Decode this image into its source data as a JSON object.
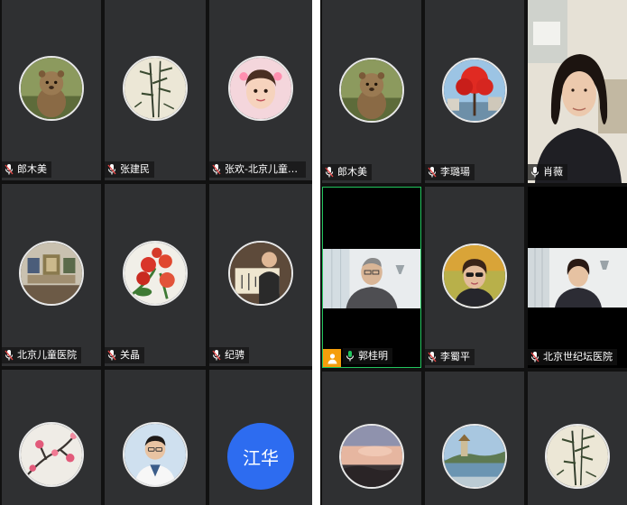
{
  "left_panel": {
    "tiles": [
      {
        "name": "郎木美",
        "mic": "muted",
        "avatar_icon": "quokka-avatar-icon"
      },
      {
        "name": "张建民",
        "mic": "muted",
        "avatar_icon": "bamboo-painting-avatar-icon"
      },
      {
        "name": "张欢-北京儿童医院",
        "mic": "muted",
        "avatar_icon": "child-photo-avatar-icon"
      },
      {
        "name": "北京儿童医院",
        "mic": "muted",
        "avatar_icon": "gallery-room-avatar-icon"
      },
      {
        "name": "关晶",
        "mic": "muted",
        "avatar_icon": "red-flowers-avatar-icon"
      },
      {
        "name": "纪骋",
        "mic": "muted",
        "avatar_icon": "calligraphy-avatar-icon"
      },
      {
        "name": "",
        "mic": "none",
        "avatar_icon": "plum-blossom-avatar-icon"
      },
      {
        "name": "",
        "mic": "none",
        "avatar_icon": "doctor-avatar-icon"
      },
      {
        "name": "",
        "mic": "none",
        "initial_avatar": "江华"
      }
    ]
  },
  "right_panel": {
    "tiles": [
      {
        "name": "郎木美",
        "mic": "muted",
        "avatar_icon": "quokka-avatar-icon"
      },
      {
        "name": "李璐瑒",
        "mic": "muted",
        "avatar_icon": "red-tree-avatar-icon"
      },
      {
        "name": "肖薇",
        "mic": "on",
        "video": "woman-video-icon"
      },
      {
        "name": "郭桂明",
        "mic": "speaking",
        "video": "man-office-video-icon",
        "active_speaker": true,
        "badge_icon": "person-badge-icon"
      },
      {
        "name": "李蜀平",
        "mic": "muted",
        "avatar_icon": "woman-sunglasses-avatar-icon"
      },
      {
        "name": "北京世纪坛医院",
        "mic": "muted",
        "video": "woman-office-video-icon"
      },
      {
        "name": "",
        "mic": "none",
        "avatar_icon": "sunset-sky-avatar-icon"
      },
      {
        "name": "",
        "mic": "none",
        "avatar_icon": "lake-pagoda-avatar-icon"
      },
      {
        "name": "",
        "mic": "none",
        "avatar_icon": "bamboo-painting-avatar-icon"
      }
    ]
  },
  "colors": {
    "tile_bg": "#2f3032",
    "muted_mic": "#e04444",
    "speaking_mic": "#22c55e",
    "active_border": "#22c55e",
    "initial_avatar_bg": "#2d6cf0",
    "badge_bg": "#f59e0b"
  }
}
